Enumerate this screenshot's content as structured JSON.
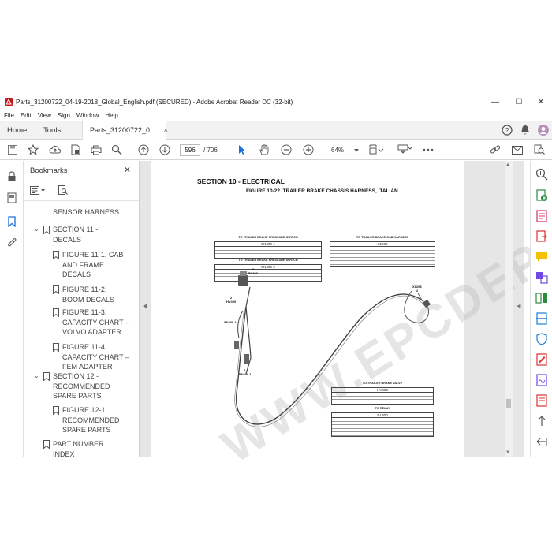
{
  "window": {
    "title": "Parts_31200722_04-19-2018_Global_English.pdf (SECURED) - Adobe Acrobat Reader DC (32-bit)",
    "minimize": "—",
    "maximize": "☐",
    "close": "✕"
  },
  "menu": [
    "File",
    "Edit",
    "View",
    "Sign",
    "Window",
    "Help"
  ],
  "tabs": {
    "home": "Home",
    "tools": "Tools",
    "doc": "Parts_31200722_0...",
    "doc_close": "×"
  },
  "toolbar": {
    "page_current": "596",
    "page_total": "/ 706",
    "zoom": "64%"
  },
  "bookmarks": {
    "heading": "Bookmarks",
    "close": "✕",
    "items": [
      {
        "label": "SENSOR HARNESS",
        "level": 2,
        "chevron": ""
      },
      {
        "label": "SECTION 11 - DECALS",
        "level": 1,
        "chevron": "⌄"
      },
      {
        "label": "FIGURE 11-1. CAB AND FRAME DECALS",
        "level": 2,
        "chevron": ""
      },
      {
        "label": "FIGURE 11-2. BOOM DECALS",
        "level": 2,
        "chevron": ""
      },
      {
        "label": "FIGURE 11-3. CAPACITY CHART – VOLVO ADAPTER",
        "level": 2,
        "chevron": ""
      },
      {
        "label": "FIGURE 11-4. CAPACITY CHART – FEM ADAPTER",
        "level": 2,
        "chevron": ""
      },
      {
        "label": "SECTION 12 - RECOMMENDED SPARE PARTS",
        "level": 1,
        "chevron": "⌄"
      },
      {
        "label": "FIGURE 12-1. RECOMMENDED SPARE PARTS",
        "level": 2,
        "chevron": ""
      },
      {
        "label": "PART NUMBER INDEX",
        "level": 1,
        "chevron": ""
      }
    ]
  },
  "document": {
    "section_title": "SECTION 10 - ELECTRICAL",
    "figure_title": "FIGURE 10-22. TRAILER BRAKE CHASSIS HARNESS, ITALIAN",
    "watermark": "WWW.EPCDEPOT.COM",
    "tables": [
      {
        "caption": "TO TRAILER BRAKE PRESSURE SWITCH",
        "header": "SN400-1"
      },
      {
        "caption": "TO TRAILER BRAKE PRESSURE SWITCH",
        "header": "SN400-2"
      },
      {
        "caption": "TO TRAILER BRAKE CAB HARNESS",
        "header": "X1208"
      },
      {
        "caption": "TO TRAILER BRAKE VALVE",
        "header": "HV400"
      },
      {
        "caption": "TO RELAY",
        "header": "RL300"
      }
    ],
    "labels": {
      "rl300": "3\nRL300",
      "hv400": "2\nHV400",
      "sn4002": "SN400 2",
      "sn4001": "1\nSN400 1",
      "x1208": "X1208\n4"
    }
  }
}
